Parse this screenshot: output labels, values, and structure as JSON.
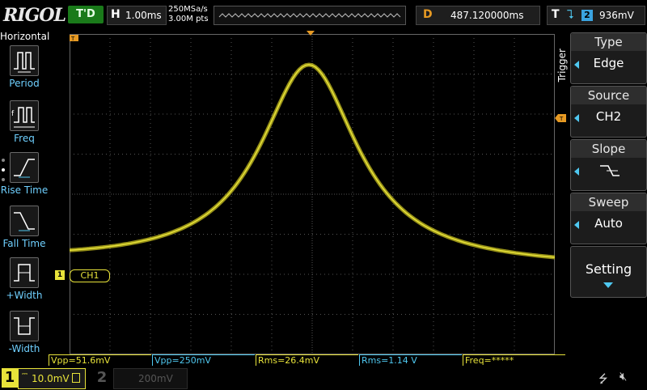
{
  "topbar": {
    "logo": "RIGOL",
    "run_status": "T'D",
    "timebase_label": "H",
    "timebase_value": "1.00ms",
    "sample_rate": "250MSa/s",
    "mem_depth": "3.00M pts",
    "delay_label": "D",
    "delay_value": "487.120000ms",
    "trigger_label": "T",
    "trigger_source": "2",
    "trigger_level": "936mV"
  },
  "left_menu": {
    "title": "Horizontal",
    "items": [
      {
        "label": "Period",
        "icon": "period-icon"
      },
      {
        "label": "Freq",
        "icon": "freq-icon"
      },
      {
        "label": "Rise Time",
        "icon": "rise-time-icon"
      },
      {
        "label": "Fall Time",
        "icon": "fall-time-icon"
      },
      {
        "label": "+Width",
        "icon": "pos-width-icon"
      },
      {
        "label": "-Width",
        "icon": "neg-width-icon"
      }
    ]
  },
  "right_menu": {
    "vertical_title": "Trigger",
    "buttons": [
      {
        "head": "Type",
        "value": "Edge"
      },
      {
        "head": "Source",
        "value": "CH2"
      },
      {
        "head": "Slope",
        "value": "↘"
      },
      {
        "head": "Sweep",
        "value": "Auto"
      }
    ],
    "setting_label": "Setting"
  },
  "measurements": [
    {
      "text": "Vpp=51.6mV",
      "color": "#e8e33a"
    },
    {
      "text": "Vpp=250mV",
      "color": "#4fc8f0"
    },
    {
      "text": "Rms=26.4mV",
      "color": "#e8e33a"
    },
    {
      "text": "Rms=1.14 V",
      "color": "#4fc8f0"
    },
    {
      "text": "Freq=*****",
      "color": "#e8e33a"
    }
  ],
  "channels": {
    "ch1_number": "1",
    "ch1_scale": "10.0mV",
    "ch1_label": "CH1",
    "ch1_marker": "1",
    "ch2_number": "2",
    "ch2_scale": "200mV"
  },
  "colors": {
    "ch1": "#e8e33a",
    "ch2": "#4fc8f0",
    "trigger_marker": "#e79a23",
    "grid": "#555555"
  }
}
